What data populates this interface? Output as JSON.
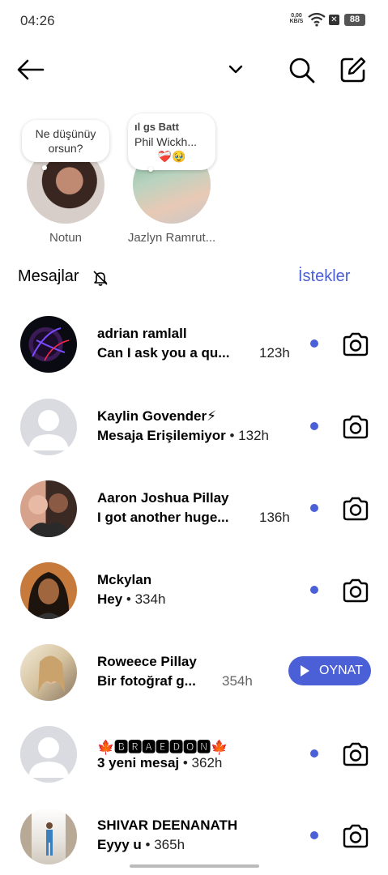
{
  "status_bar": {
    "time": "04:26",
    "net_speed_value": "0,00",
    "net_speed_unit": "KB/S",
    "battery": "88"
  },
  "notes": [
    {
      "bubble": "Ne düşünüy orsun?",
      "label": "Notun"
    },
    {
      "bubble_line1": "ıl gs    Batt",
      "bubble_line2": "Phil Wickh...",
      "bubble_line3": "❤️‍🩹🥹",
      "label": "Jazlyn Ramrut..."
    }
  ],
  "section": {
    "title": "Mesajlar",
    "requests": "İstekler"
  },
  "messages": [
    {
      "name": "adrian ramlall",
      "preview": "Can I ask you a qu...",
      "time": "123h"
    },
    {
      "name": "Kaylin Govender⚡",
      "preview": "Mesaja Erişilemiyor",
      "time": "• 132h"
    },
    {
      "name": "Aaron Joshua Pillay",
      "preview": "I got another huge...",
      "time": "136h"
    },
    {
      "name": "Mckylan",
      "preview": "Hey",
      "time": "• 334h"
    },
    {
      "name": "Roweece Pillay",
      "preview": "Bir fotoğraf g...",
      "time": "354h",
      "action": "OYNAT"
    },
    {
      "name": "🍁🅱🆁🅰🅴🅳🅾🅽🍁",
      "preview": "3 yeni mesaj",
      "time": "• 362h"
    },
    {
      "name": "SHIVAR DEENANATH",
      "preview": "Eyyy u",
      "time": "• 365h"
    }
  ],
  "colors": {
    "accent": "#4b5fd6"
  }
}
